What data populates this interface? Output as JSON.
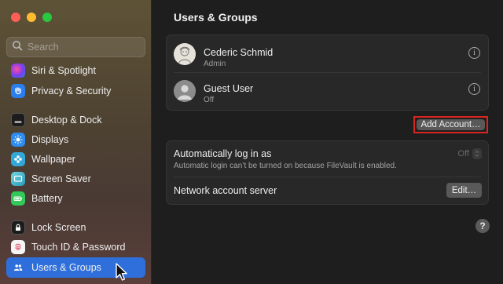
{
  "window": {
    "title": "Users & Groups"
  },
  "search": {
    "placeholder": "Search"
  },
  "sidebar": {
    "items": [
      {
        "label": "Siri & Spotlight",
        "icon": "siri-icon",
        "color": "#8a3fe0"
      },
      {
        "label": "Privacy & Security",
        "icon": "hand-icon",
        "color": "#2a7ef0"
      },
      {
        "label": "Desktop & Dock",
        "icon": "dock-icon",
        "color": "#1c1c1c"
      },
      {
        "label": "Displays",
        "icon": "sun-icon",
        "color": "#2d8cf0"
      },
      {
        "label": "Wallpaper",
        "icon": "flower-icon",
        "color": "#31a8d8"
      },
      {
        "label": "Screen Saver",
        "icon": "screen-saver-icon",
        "color": "#3bb4c8"
      },
      {
        "label": "Battery",
        "icon": "battery-icon",
        "color": "#34c759"
      },
      {
        "label": "Lock Screen",
        "icon": "lock-icon",
        "color": "#1c1c1c"
      },
      {
        "label": "Touch ID & Password",
        "icon": "fingerprint-icon",
        "color": "#f5f5f5"
      },
      {
        "label": "Users & Groups",
        "icon": "users-icon",
        "color": "#2f6fdc",
        "selected": true
      }
    ]
  },
  "users": [
    {
      "name": "Cederic Schmid",
      "role": "Admin"
    },
    {
      "name": "Guest User",
      "role": "Off"
    }
  ],
  "add_account_label": "Add Account…",
  "auto_login": {
    "label": "Automatically log in as",
    "value": "Off",
    "note": "Automatic login can’t be turned on because FileVault is enabled."
  },
  "network_server": {
    "label": "Network account server",
    "button": "Edit…"
  },
  "help_label": "?",
  "info_label": "i",
  "colors": {
    "accent": "#2f6fdc",
    "highlight_border": "#d7261f"
  }
}
